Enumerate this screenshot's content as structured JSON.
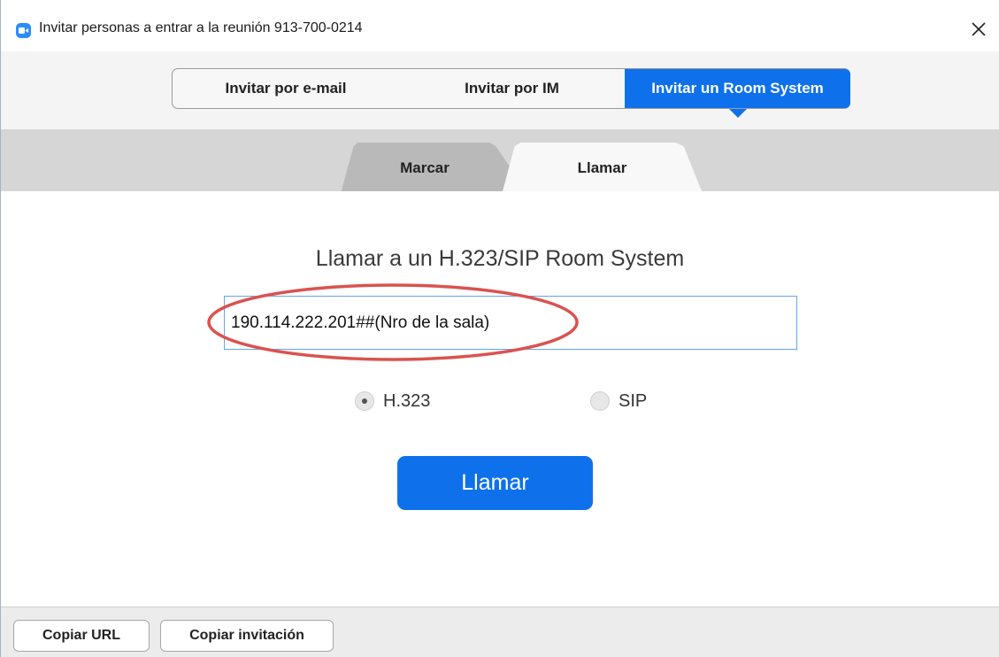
{
  "window": {
    "title": "Invitar personas a entrar a la reunión 913-700-0214",
    "app_icon": "zoom-video-icon",
    "close_icon": "close-icon"
  },
  "top_tabs": [
    {
      "label": "Invitar por e-mail",
      "selected": false
    },
    {
      "label": "Invitar por IM",
      "selected": false
    },
    {
      "label": "Invitar un Room System",
      "selected": true
    }
  ],
  "sub_tabs": [
    {
      "label": "Marcar",
      "selected": false
    },
    {
      "label": "Llamar",
      "selected": true
    }
  ],
  "main": {
    "heading": "Llamar a un H.323/SIP Room System",
    "address_value": "190.114.222.201##(Nro de la sala)",
    "protocols": [
      {
        "label": "H.323",
        "checked": true
      },
      {
        "label": "SIP",
        "checked": false
      }
    ],
    "call_button": "Llamar"
  },
  "footer": {
    "copy_url": "Copiar URL",
    "copy_invitation": "Copiar invitación"
  },
  "colors": {
    "accent": "#0e71eb",
    "annotation_circle": "#d9534f"
  }
}
